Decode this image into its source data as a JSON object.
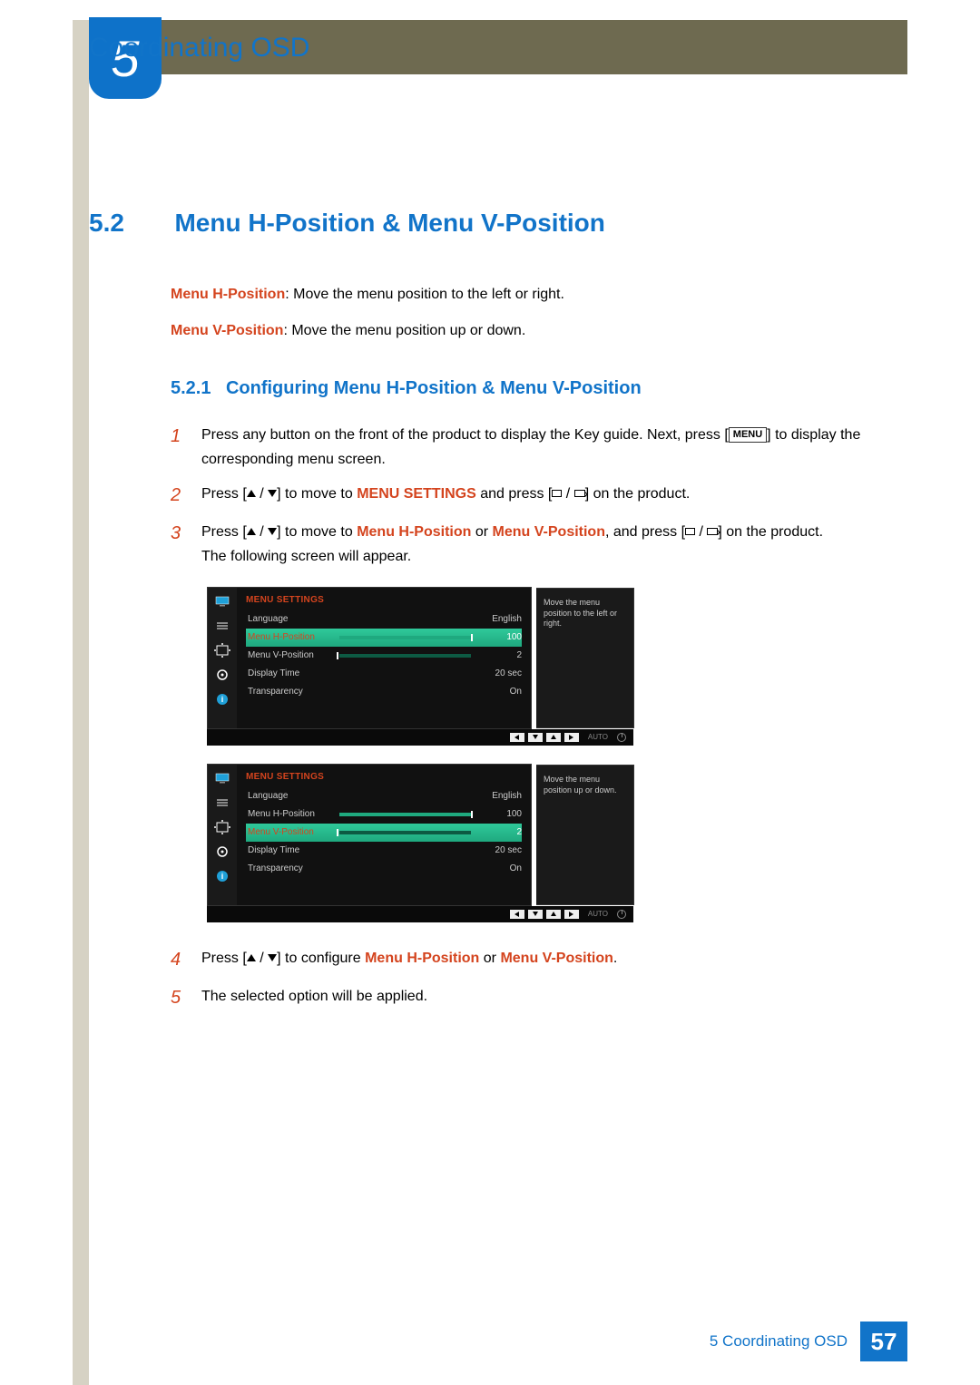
{
  "chapter": {
    "number": "5",
    "title": "Coordinating OSD"
  },
  "section": {
    "number": "5.2",
    "title": "Menu H-Position & Menu V-Position"
  },
  "descriptions": {
    "h_label": "Menu H-Position",
    "h_text": ": Move the menu position to the left or right.",
    "v_label": "Menu V-Position",
    "v_text": ": Move the menu position up or down."
  },
  "subsection": {
    "number": "5.2.1",
    "title": "Configuring Menu H-Position & Menu V-Position"
  },
  "steps": {
    "s1a": "Press any button on the front of the product to display the Key guide. Next, press [",
    "s1_menu": "MENU",
    "s1b": "] to display the corresponding menu screen.",
    "s2a": "Press [",
    "s2b": "] to move to ",
    "s2_target": "MENU SETTINGS",
    "s2c": " and press [",
    "s2d": "] on the product.",
    "s3a": "Press [",
    "s3b": "] to move to ",
    "s3_h": "Menu H-Position",
    "s3_or": " or ",
    "s3_v": "Menu V-Position",
    "s3c": ", and press [",
    "s3d": "] on the product.",
    "s3e": "The following screen will appear.",
    "s4a": "Press [",
    "s4b": "] to configure ",
    "s4_h": "Menu H-Position",
    "s4_or": " or ",
    "s4_v": "Menu V-Position",
    "s4c": ".",
    "s5": "The selected option will be applied."
  },
  "osd1": {
    "heading": "MENU SETTINGS",
    "rows": {
      "language": {
        "label": "Language",
        "value": "English"
      },
      "h": {
        "label": "Menu H-Position",
        "value": "100"
      },
      "v": {
        "label": "Menu V-Position",
        "value": "2"
      },
      "time": {
        "label": "Display Time",
        "value": "20 sec"
      },
      "trans": {
        "label": "Transparency",
        "value": "On"
      }
    },
    "tooltip": "Move the menu position to the left or right.",
    "auto": "AUTO"
  },
  "osd2": {
    "heading": "MENU SETTINGS",
    "rows": {
      "language": {
        "label": "Language",
        "value": "English"
      },
      "h": {
        "label": "Menu H-Position",
        "value": "100"
      },
      "v": {
        "label": "Menu V-Position",
        "value": "2"
      },
      "time": {
        "label": "Display Time",
        "value": "20 sec"
      },
      "trans": {
        "label": "Transparency",
        "value": "On"
      }
    },
    "tooltip": "Move the menu position up or down.",
    "auto": "AUTO"
  },
  "footer": {
    "label": "5 Coordinating OSD",
    "page": "57"
  }
}
